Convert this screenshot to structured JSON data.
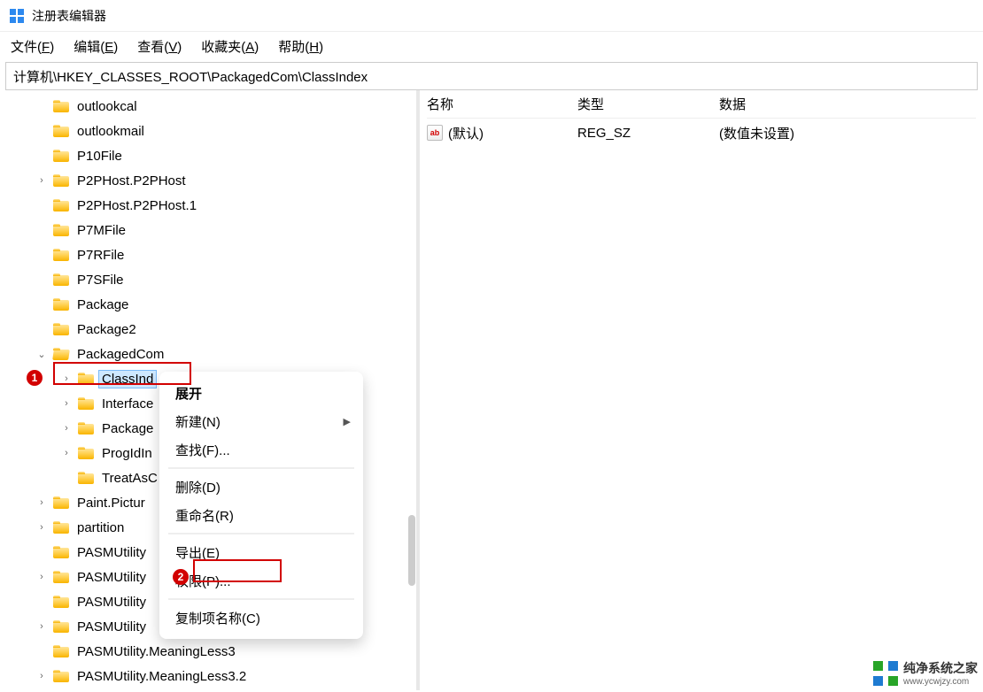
{
  "app_title": "注册表编辑器",
  "menubar": [
    {
      "label": "文件",
      "hotkey": "F"
    },
    {
      "label": "编辑",
      "hotkey": "E"
    },
    {
      "label": "查看",
      "hotkey": "V"
    },
    {
      "label": "收藏夹",
      "hotkey": "A"
    },
    {
      "label": "帮助",
      "hotkey": "H"
    }
  ],
  "address_path": "计算机\\HKEY_CLASSES_ROOT\\PackagedCom\\ClassIndex",
  "tree_items": [
    {
      "level": 1,
      "exp": "",
      "label": "outlookcal"
    },
    {
      "level": 1,
      "exp": "",
      "label": "outlookmail"
    },
    {
      "level": 1,
      "exp": "",
      "label": "P10File"
    },
    {
      "level": 1,
      "exp": ">",
      "label": "P2PHost.P2PHost"
    },
    {
      "level": 1,
      "exp": "",
      "label": "P2PHost.P2PHost.1"
    },
    {
      "level": 1,
      "exp": "",
      "label": "P7MFile"
    },
    {
      "level": 1,
      "exp": "",
      "label": "P7RFile"
    },
    {
      "level": 1,
      "exp": "",
      "label": "P7SFile"
    },
    {
      "level": 1,
      "exp": "",
      "label": "Package"
    },
    {
      "level": 1,
      "exp": "",
      "label": "Package2"
    },
    {
      "level": 1,
      "exp": "v",
      "label": "PackagedCom",
      "open": true
    },
    {
      "level": 2,
      "exp": ">",
      "label": "ClassInd",
      "selected": true,
      "name": "ClassIndex"
    },
    {
      "level": 2,
      "exp": ">",
      "label": "Interface"
    },
    {
      "level": 2,
      "exp": ">",
      "label": "Package"
    },
    {
      "level": 2,
      "exp": ">",
      "label": "ProgIdIn"
    },
    {
      "level": 2,
      "exp": "",
      "label": "TreatAsC"
    },
    {
      "level": 1,
      "exp": ">",
      "label": "Paint.Pictur"
    },
    {
      "level": 1,
      "exp": ">",
      "label": "partition"
    },
    {
      "level": 1,
      "exp": "",
      "label": "PASMUtility"
    },
    {
      "level": 1,
      "exp": ">",
      "label": "PASMUtility"
    },
    {
      "level": 1,
      "exp": "",
      "label": "PASMUtility"
    },
    {
      "level": 1,
      "exp": ">",
      "label": "PASMUtility"
    },
    {
      "level": 1,
      "exp": "",
      "label": "PASMUtility.MeaningLess3"
    },
    {
      "level": 1,
      "exp": ">",
      "label": "PASMUtility.MeaningLess3.2"
    }
  ],
  "context_menu": {
    "items": [
      {
        "label": "展开",
        "bold": true
      },
      {
        "label": "新建(N)",
        "submenu": true
      },
      {
        "label": "查找(F)..."
      },
      {
        "sep": true
      },
      {
        "label": "删除(D)"
      },
      {
        "label": "重命名(R)"
      },
      {
        "sep": true
      },
      {
        "label": "导出(E)"
      },
      {
        "label": "权限(P)...",
        "highlight": true
      },
      {
        "sep": true
      },
      {
        "label": "复制项名称(C)"
      }
    ]
  },
  "values": {
    "headers": {
      "name": "名称",
      "type": "类型",
      "data": "数据"
    },
    "rows": [
      {
        "name": "(默认)",
        "type": "REG_SZ",
        "data": "(数值未设置)"
      }
    ]
  },
  "callouts": {
    "one": "1",
    "two": "2"
  },
  "watermark": {
    "title": "纯净系统之家",
    "url": "www.ycwjzy.com"
  }
}
